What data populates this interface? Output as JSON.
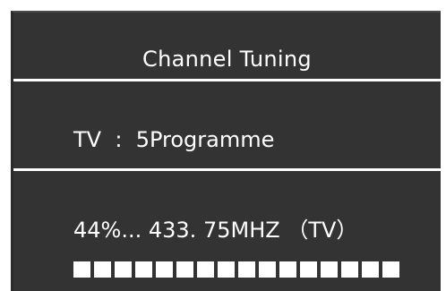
{
  "menu": {
    "title": "Channel Tuning",
    "source_label": "TV",
    "separator": ":",
    "programme": "5Programme",
    "progress_text": "44%...",
    "frequency": "433. 75MHZ",
    "band": "（TV）",
    "progress_percent": 44,
    "progress_segments_total": 16,
    "progress_segments_filled": 16
  },
  "colors": {
    "panel": "#333333",
    "text": "#ffffff",
    "divider": "#ffffff"
  }
}
